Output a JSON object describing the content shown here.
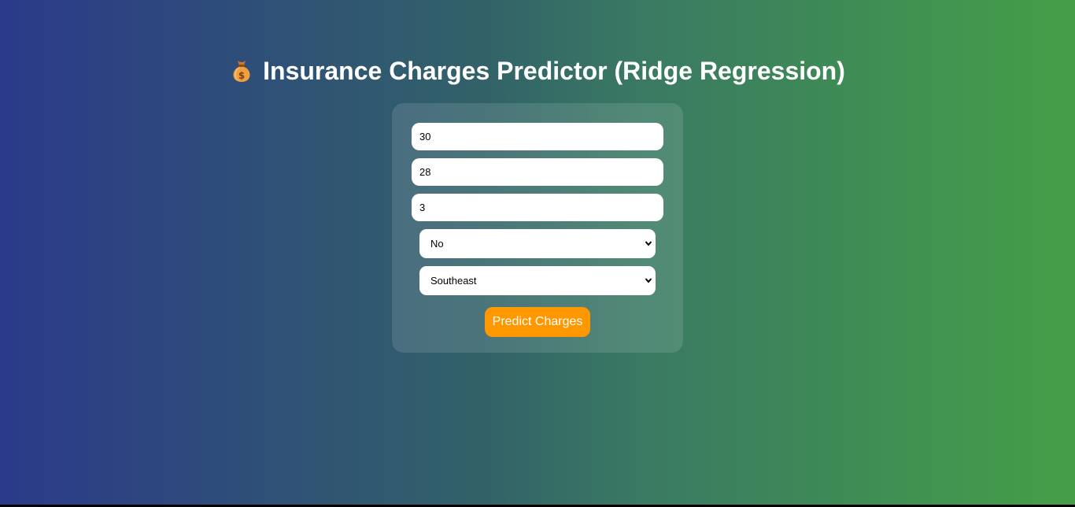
{
  "header": {
    "title": "Insurance Charges Predictor (Ridge Regression)",
    "icon": "money-bag-icon"
  },
  "form": {
    "age": {
      "value": "30"
    },
    "bmi": {
      "value": "28"
    },
    "children": {
      "value": "3"
    },
    "smoker": {
      "selected": "No"
    },
    "region": {
      "selected": "Southeast"
    },
    "submit_label": "Predict Charges"
  },
  "colors": {
    "gradient_start": "#2b3a8a",
    "gradient_end": "#449f47",
    "button": "#ff9800",
    "title": "#ffffff"
  }
}
